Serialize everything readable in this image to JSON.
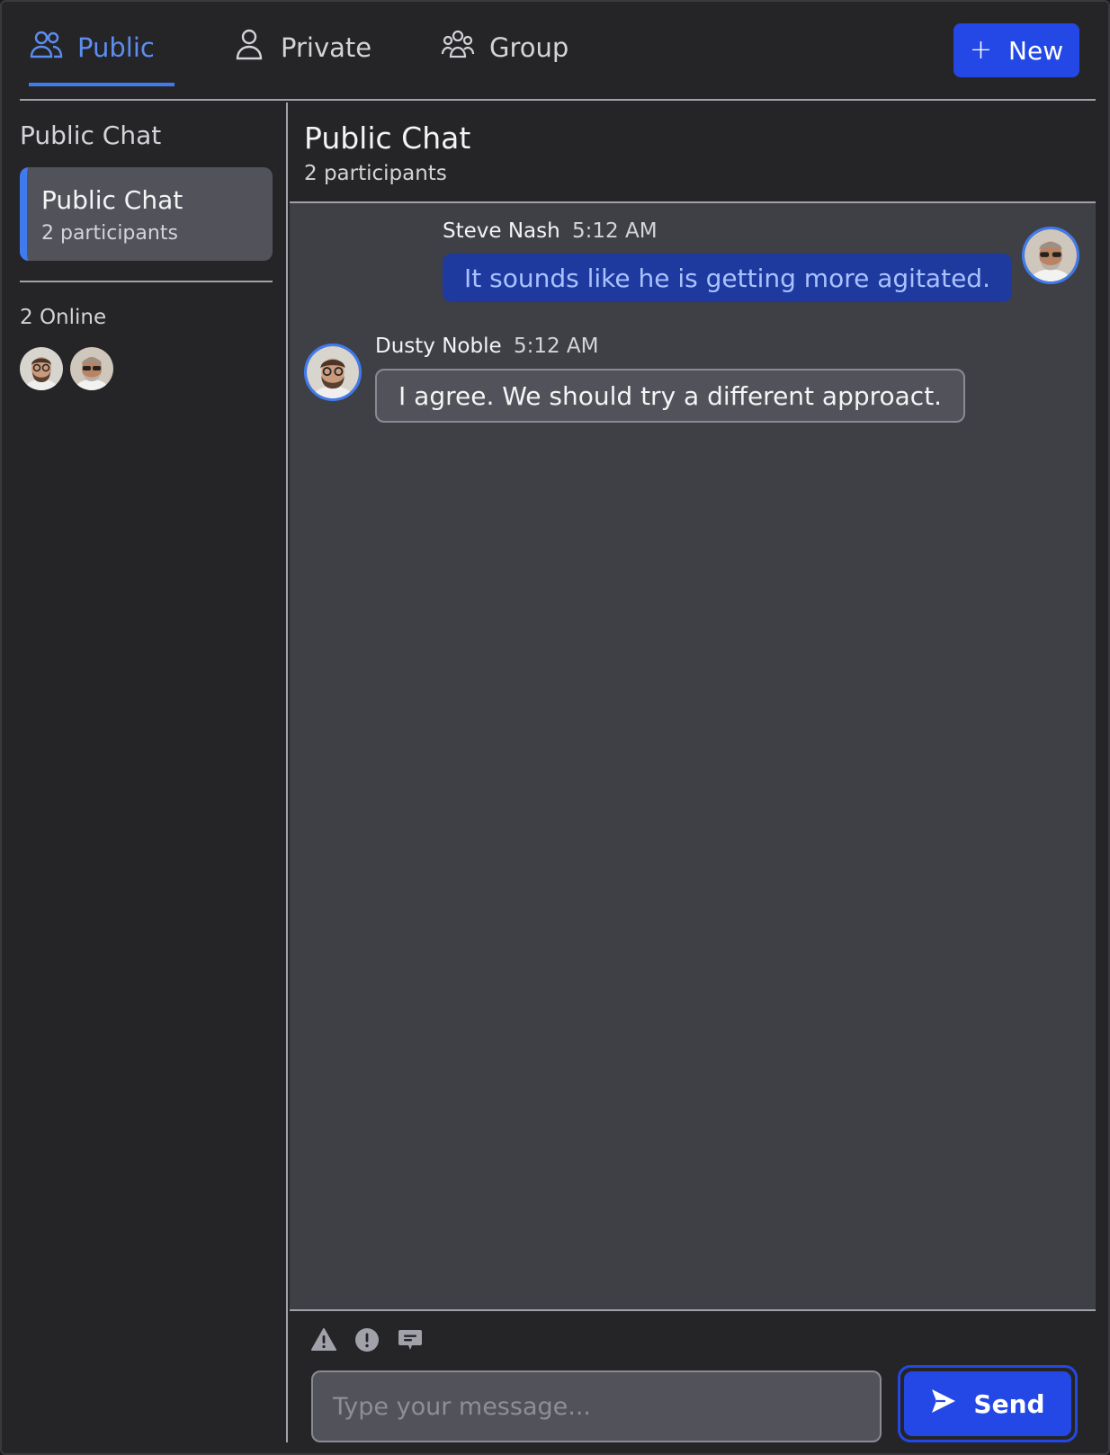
{
  "tabs": [
    {
      "label": "Public",
      "icon": "users-icon",
      "active": true
    },
    {
      "label": "Private",
      "icon": "user-icon",
      "active": false
    },
    {
      "label": "Group",
      "icon": "user-group-icon",
      "active": false
    }
  ],
  "new_button": {
    "label": "New",
    "icon": "plus-icon"
  },
  "sidebar": {
    "heading": "Public Chat",
    "rooms": [
      {
        "name": "Public Chat",
        "participants": "2 participants",
        "selected": true
      }
    ],
    "online_label": "2 Online"
  },
  "chat": {
    "title": "Public Chat",
    "subtitle": "2 participants",
    "messages": [
      {
        "author": "Steve Nash",
        "time": "5:12 AM",
        "text": "It sounds like he is getting more agitated.",
        "mine": true
      },
      {
        "author": "Dusty Noble",
        "time": "5:12 AM",
        "text": "I agree. We should try a different approact.",
        "mine": false
      }
    ]
  },
  "composer": {
    "tools": [
      "warning-icon",
      "exclamation-icon",
      "comment-icon"
    ],
    "placeholder": "Type your message...",
    "value": "",
    "send_label": "Send"
  },
  "colors": {
    "accent": "#3f7bef",
    "button": "#2448e6",
    "background": "#252528",
    "chat_background": "#3f3f46",
    "own_bubble": "#1e3a9f"
  }
}
